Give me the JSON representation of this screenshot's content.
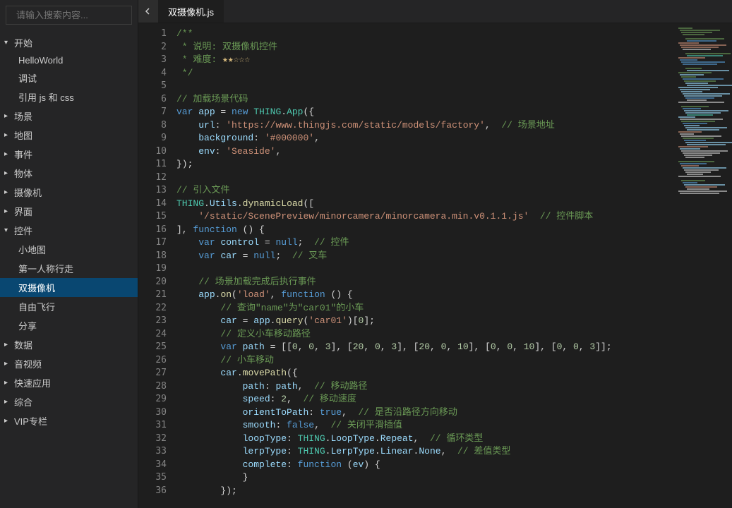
{
  "search": {
    "placeholder": "请输入搜索内容..."
  },
  "sidebar": {
    "sections": [
      {
        "label": "开始",
        "expanded": true,
        "children": [
          {
            "label": "HelloWorld"
          },
          {
            "label": "调试"
          },
          {
            "label": "引用 js 和 css"
          }
        ]
      },
      {
        "label": "场景",
        "expanded": false
      },
      {
        "label": "地图",
        "expanded": false
      },
      {
        "label": "事件",
        "expanded": false
      },
      {
        "label": "物体",
        "expanded": false
      },
      {
        "label": "摄像机",
        "expanded": false
      },
      {
        "label": "界面",
        "expanded": false
      },
      {
        "label": "控件",
        "expanded": true,
        "children": [
          {
            "label": "小地图"
          },
          {
            "label": "第一人称行走"
          },
          {
            "label": "双摄像机",
            "selected": true
          },
          {
            "label": "自由飞行"
          },
          {
            "label": "分享"
          }
        ]
      },
      {
        "label": "数据",
        "expanded": false
      },
      {
        "label": "音视频",
        "expanded": false
      },
      {
        "label": "快速应用",
        "expanded": false
      },
      {
        "label": "综合",
        "expanded": false
      },
      {
        "label": "VIP专栏",
        "expanded": false
      }
    ]
  },
  "tab": {
    "title": "双摄像机.js"
  },
  "code": {
    "lines": [
      {
        "n": 1,
        "t": [
          [
            "c-green",
            "/**"
          ]
        ]
      },
      {
        "n": 2,
        "t": [
          [
            "c-green",
            " * 说明: 双摄像机控件"
          ]
        ]
      },
      {
        "n": 3,
        "t": [
          [
            "c-green",
            " * 难度: "
          ],
          [
            "c-star",
            "★★☆☆☆"
          ]
        ]
      },
      {
        "n": 4,
        "t": [
          [
            "c-green",
            " */"
          ]
        ]
      },
      {
        "n": 5,
        "t": []
      },
      {
        "n": 6,
        "t": [
          [
            "c-green",
            "// 加载场景代码"
          ]
        ]
      },
      {
        "n": 7,
        "t": [
          [
            "c-blue",
            "var"
          ],
          [
            "",
            " "
          ],
          [
            "c-lblue",
            "app"
          ],
          [
            "",
            " = "
          ],
          [
            "c-blue",
            "new"
          ],
          [
            "",
            " "
          ],
          [
            "c-teal",
            "THING"
          ],
          [
            "",
            "."
          ],
          [
            "c-teal",
            "App"
          ],
          [
            "",
            "({"
          ]
        ]
      },
      {
        "n": 8,
        "t": [
          [
            "",
            "    "
          ],
          [
            "c-lblue",
            "url"
          ],
          [
            "",
            ": "
          ],
          [
            "c-orange",
            "'https://www.thingjs.com/static/models/factory'"
          ],
          [
            "",
            ",  "
          ],
          [
            "c-green",
            "// 场景地址"
          ]
        ]
      },
      {
        "n": 9,
        "t": [
          [
            "",
            "    "
          ],
          [
            "c-lblue",
            "background"
          ],
          [
            "",
            ": "
          ],
          [
            "c-orange",
            "'#000000'"
          ],
          [
            "",
            ","
          ]
        ]
      },
      {
        "n": 10,
        "t": [
          [
            "",
            "    "
          ],
          [
            "c-lblue",
            "env"
          ],
          [
            "",
            ": "
          ],
          [
            "c-orange",
            "'Seaside'"
          ],
          [
            "",
            ","
          ]
        ]
      },
      {
        "n": 11,
        "t": [
          [
            "",
            "});"
          ]
        ]
      },
      {
        "n": 12,
        "t": []
      },
      {
        "n": 13,
        "t": [
          [
            "c-green",
            "// 引入文件"
          ]
        ]
      },
      {
        "n": 14,
        "t": [
          [
            "c-teal",
            "THING"
          ],
          [
            "",
            "."
          ],
          [
            "c-lblue",
            "Utils"
          ],
          [
            "",
            "."
          ],
          [
            "c-yellow",
            "dynamicLoad"
          ],
          [
            "",
            "(["
          ]
        ]
      },
      {
        "n": 15,
        "t": [
          [
            "",
            "    "
          ],
          [
            "c-orange",
            "'/static/ScenePreview/minorcamera/minorcamera.min.v0.1.1.js'"
          ],
          [
            "",
            "  "
          ],
          [
            "c-green",
            "// 控件脚本"
          ]
        ]
      },
      {
        "n": 16,
        "t": [
          [
            "",
            "], "
          ],
          [
            "c-blue",
            "function"
          ],
          [
            "",
            " () {"
          ]
        ]
      },
      {
        "n": 17,
        "t": [
          [
            "",
            "    "
          ],
          [
            "c-blue",
            "var"
          ],
          [
            "",
            " "
          ],
          [
            "c-lblue",
            "control"
          ],
          [
            "",
            " = "
          ],
          [
            "c-blue",
            "null"
          ],
          [
            "",
            ";  "
          ],
          [
            "c-green",
            "// 控件"
          ]
        ]
      },
      {
        "n": 18,
        "t": [
          [
            "",
            "    "
          ],
          [
            "c-blue",
            "var"
          ],
          [
            "",
            " "
          ],
          [
            "c-lblue",
            "car"
          ],
          [
            "",
            " = "
          ],
          [
            "c-blue",
            "null"
          ],
          [
            "",
            ";  "
          ],
          [
            "c-green",
            "// 叉车"
          ]
        ]
      },
      {
        "n": 19,
        "t": []
      },
      {
        "n": 20,
        "t": [
          [
            "",
            "    "
          ],
          [
            "c-green",
            "// 场景加载完成后执行事件"
          ]
        ]
      },
      {
        "n": 21,
        "t": [
          [
            "",
            "    "
          ],
          [
            "c-lblue",
            "app"
          ],
          [
            "",
            "."
          ],
          [
            "c-yellow",
            "on"
          ],
          [
            "",
            "("
          ],
          [
            "c-orange",
            "'load'"
          ],
          [
            "",
            ", "
          ],
          [
            "c-blue",
            "function"
          ],
          [
            "",
            " () {"
          ]
        ]
      },
      {
        "n": 22,
        "t": [
          [
            "",
            "        "
          ],
          [
            "c-green",
            "// 查询\"name\"为\"car01\"的小车"
          ]
        ]
      },
      {
        "n": 23,
        "t": [
          [
            "",
            "        "
          ],
          [
            "c-lblue",
            "car"
          ],
          [
            "",
            " = "
          ],
          [
            "c-lblue",
            "app"
          ],
          [
            "",
            "."
          ],
          [
            "c-yellow",
            "query"
          ],
          [
            "",
            "("
          ],
          [
            "c-orange",
            "'car01'"
          ],
          [
            "",
            ")["
          ],
          [
            "c-num",
            "0"
          ],
          [
            "",
            "];"
          ]
        ]
      },
      {
        "n": 24,
        "t": [
          [
            "",
            "        "
          ],
          [
            "c-green",
            "// 定义小车移动路径"
          ]
        ]
      },
      {
        "n": 25,
        "t": [
          [
            "",
            "        "
          ],
          [
            "c-blue",
            "var"
          ],
          [
            "",
            " "
          ],
          [
            "c-lblue",
            "path"
          ],
          [
            "",
            " = [["
          ],
          [
            "c-num",
            "0"
          ],
          [
            "",
            ", "
          ],
          [
            "c-num",
            "0"
          ],
          [
            "",
            ", "
          ],
          [
            "c-num",
            "3"
          ],
          [
            "",
            "], ["
          ],
          [
            "c-num",
            "20"
          ],
          [
            "",
            ", "
          ],
          [
            "c-num",
            "0"
          ],
          [
            "",
            ", "
          ],
          [
            "c-num",
            "3"
          ],
          [
            "",
            "], ["
          ],
          [
            "c-num",
            "20"
          ],
          [
            "",
            ", "
          ],
          [
            "c-num",
            "0"
          ],
          [
            "",
            ", "
          ],
          [
            "c-num",
            "10"
          ],
          [
            "",
            "], ["
          ],
          [
            "c-num",
            "0"
          ],
          [
            "",
            ", "
          ],
          [
            "c-num",
            "0"
          ],
          [
            "",
            ", "
          ],
          [
            "c-num",
            "10"
          ],
          [
            "",
            "], ["
          ],
          [
            "c-num",
            "0"
          ],
          [
            "",
            ", "
          ],
          [
            "c-num",
            "0"
          ],
          [
            "",
            ", "
          ],
          [
            "c-num",
            "3"
          ],
          [
            "",
            "]];"
          ]
        ]
      },
      {
        "n": 26,
        "t": [
          [
            "",
            "        "
          ],
          [
            "c-green",
            "// 小车移动"
          ]
        ]
      },
      {
        "n": 27,
        "t": [
          [
            "",
            "        "
          ],
          [
            "c-lblue",
            "car"
          ],
          [
            "",
            "."
          ],
          [
            "c-yellow",
            "movePath"
          ],
          [
            "",
            "({"
          ]
        ]
      },
      {
        "n": 28,
        "t": [
          [
            "",
            "            "
          ],
          [
            "c-lblue",
            "path"
          ],
          [
            "",
            ": "
          ],
          [
            "c-lblue",
            "path"
          ],
          [
            "",
            ",  "
          ],
          [
            "c-green",
            "// 移动路径"
          ]
        ]
      },
      {
        "n": 29,
        "t": [
          [
            "",
            "            "
          ],
          [
            "c-lblue",
            "speed"
          ],
          [
            "",
            ": "
          ],
          [
            "c-num",
            "2"
          ],
          [
            "",
            ",  "
          ],
          [
            "c-green",
            "// 移动速度"
          ]
        ]
      },
      {
        "n": 30,
        "t": [
          [
            "",
            "            "
          ],
          [
            "c-lblue",
            "orientToPath"
          ],
          [
            "",
            ": "
          ],
          [
            "c-blue",
            "true"
          ],
          [
            "",
            ",  "
          ],
          [
            "c-green",
            "// 是否沿路径方向移动"
          ]
        ]
      },
      {
        "n": 31,
        "t": [
          [
            "",
            "            "
          ],
          [
            "c-lblue",
            "smooth"
          ],
          [
            "",
            ": "
          ],
          [
            "c-blue",
            "false"
          ],
          [
            "",
            ",  "
          ],
          [
            "c-green",
            "// 关闭平滑插值"
          ]
        ]
      },
      {
        "n": 32,
        "t": [
          [
            "",
            "            "
          ],
          [
            "c-lblue",
            "loopType"
          ],
          [
            "",
            ": "
          ],
          [
            "c-teal",
            "THING"
          ],
          [
            "",
            "."
          ],
          [
            "c-lblue",
            "LoopType"
          ],
          [
            "",
            "."
          ],
          [
            "c-lblue",
            "Repeat"
          ],
          [
            "",
            ",  "
          ],
          [
            "c-green",
            "// 循环类型"
          ]
        ]
      },
      {
        "n": 33,
        "t": [
          [
            "",
            "            "
          ],
          [
            "c-lblue",
            "lerpType"
          ],
          [
            "",
            ": "
          ],
          [
            "c-teal",
            "THING"
          ],
          [
            "",
            "."
          ],
          [
            "c-lblue",
            "LerpType"
          ],
          [
            "",
            "."
          ],
          [
            "c-lblue",
            "Linear"
          ],
          [
            "",
            "."
          ],
          [
            "c-lblue",
            "None"
          ],
          [
            "",
            ",  "
          ],
          [
            "c-green",
            "// 差值类型"
          ]
        ]
      },
      {
        "n": 34,
        "t": [
          [
            "",
            "            "
          ],
          [
            "c-lblue",
            "complete"
          ],
          [
            "",
            ": "
          ],
          [
            "c-blue",
            "function"
          ],
          [
            "",
            " ("
          ],
          [
            "c-lblue",
            "ev"
          ],
          [
            "",
            ") {"
          ]
        ]
      },
      {
        "n": 35,
        "t": [
          [
            "",
            "            }"
          ]
        ]
      },
      {
        "n": 36,
        "t": [
          [
            "",
            "        });"
          ]
        ]
      }
    ]
  },
  "minimap_colors": [
    "#6a9955",
    "#6a9955",
    "#6a9955",
    "#6a9955",
    "#1e1e1e",
    "#6a9955",
    "#569cd6",
    "#ce9178",
    "#ce9178",
    "#ce9178",
    "#d4d4d4",
    "#1e1e1e",
    "#6a9955",
    "#4ec9b0",
    "#ce9178",
    "#569cd6",
    "#569cd6",
    "#569cd6",
    "#1e1e1e",
    "#6a9955",
    "#9cdcfe",
    "#6a9955",
    "#9cdcfe",
    "#6a9955",
    "#569cd6",
    "#6a9955",
    "#9cdcfe",
    "#9cdcfe",
    "#9cdcfe",
    "#9cdcfe",
    "#9cdcfe",
    "#9cdcfe",
    "#9cdcfe",
    "#569cd6",
    "#d4d4d4",
    "#d4d4d4",
    "#1e1e1e",
    "#6a9955",
    "#569cd6",
    "#9cdcfe",
    "#9cdcfe",
    "#4ec9b0",
    "#9cdcfe",
    "#d4d4d4",
    "#6a9955",
    "#569cd6",
    "#9cdcfe",
    "#9cdcfe",
    "#9cdcfe",
    "#ce9178",
    "#d4d4d4",
    "#d4d4d4",
    "#6a9955",
    "#569cd6",
    "#9cdcfe",
    "#9cdcfe",
    "#ce9178",
    "#9cdcfe",
    "#d4d4d4",
    "#d4d4d4",
    "#d4d4d4",
    "#d4d4d4",
    "#1e1e1e",
    "#6a9955",
    "#569cd6",
    "#ce9178",
    "#9cdcfe",
    "#d4d4d4",
    "#d4d4d4",
    "#d4d4d4",
    "#d4d4d4",
    "#1e1e1e",
    "#6a9955",
    "#569cd6",
    "#9cdcfe",
    "#ce9178",
    "#d4d4d4",
    "#d4d4d4",
    "#d4d4d4"
  ]
}
